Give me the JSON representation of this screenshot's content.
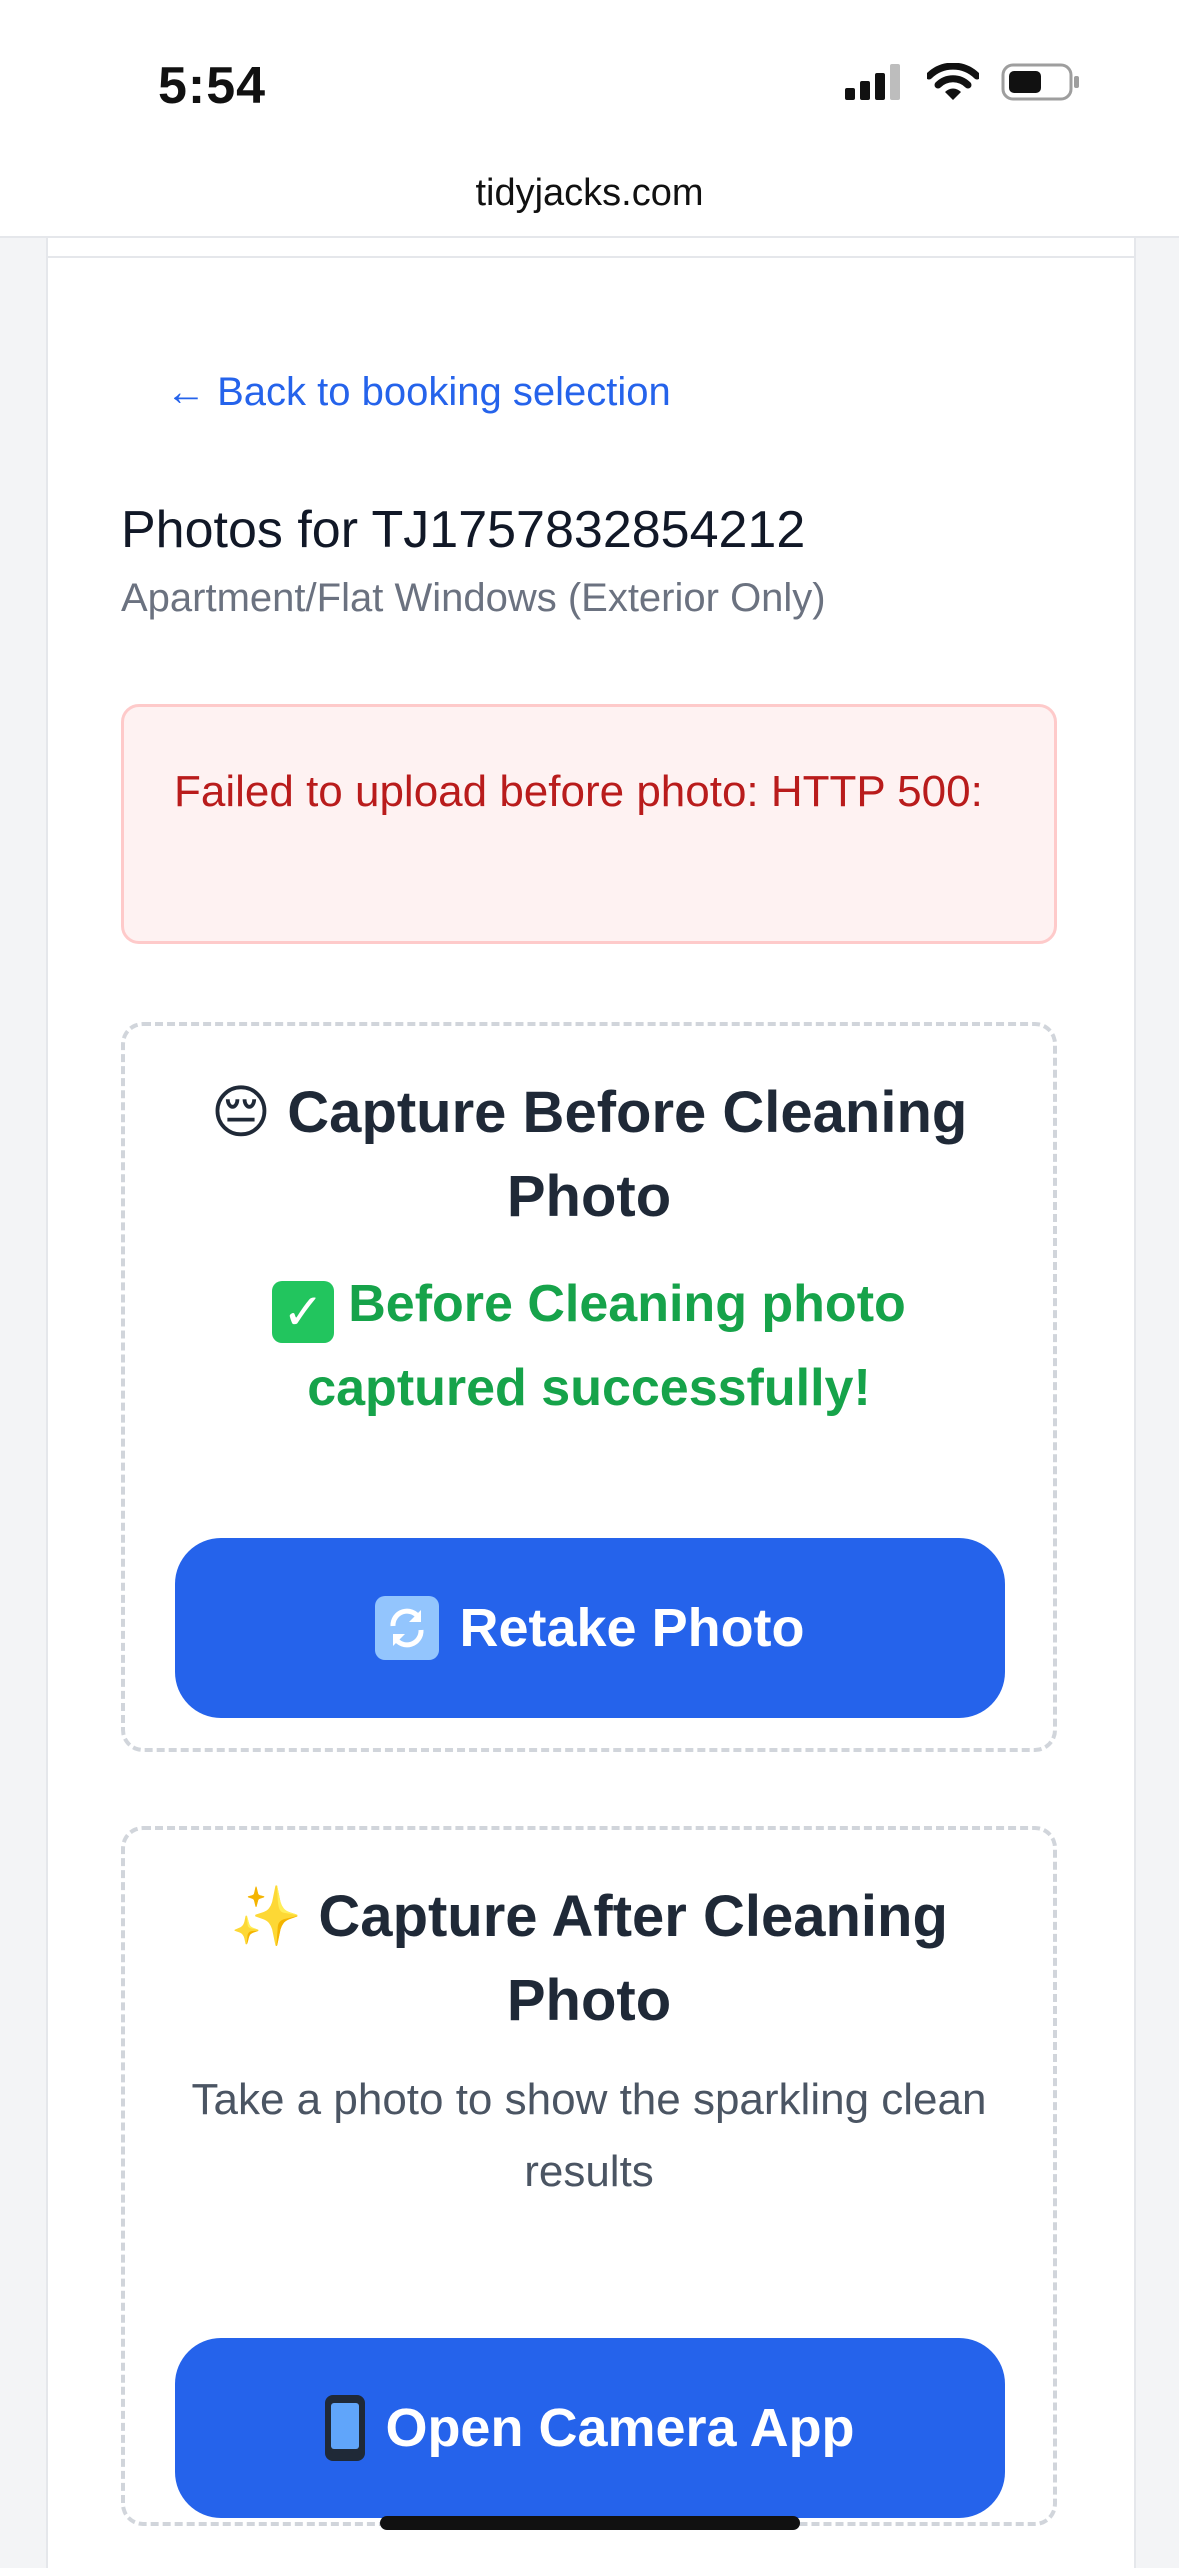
{
  "status_bar": {
    "time": "5:54",
    "icons": [
      "cellular-signal-icon",
      "wifi-icon",
      "battery-icon"
    ]
  },
  "browser": {
    "url": "tidyjacks.com"
  },
  "page": {
    "back_link": "← Back to booking selection",
    "title": "Photos for TJ1757832854212",
    "subtitle": "Apartment/Flat Windows (Exterior Only)",
    "error": "Failed to upload before photo: HTTP 500:"
  },
  "before_section": {
    "title_emoji": "😔",
    "title": "Capture Before Cleaning Photo",
    "success_icon": "check-box-icon",
    "success_message": "Before Cleaning photo captured successfully!",
    "button_icon": "refresh-icon",
    "button_label": "Retake Photo"
  },
  "after_section": {
    "title_emoji": "✨",
    "title": "Capture After Cleaning Photo",
    "description": "Take a photo to show the sparkling clean results",
    "button_icon": "mobile-phone-icon",
    "button_label": "Open Camera App"
  },
  "colors": {
    "primary": "#2563eb",
    "success": "#16a34a",
    "error_text": "#b91c1c",
    "error_bg": "#fef2f2"
  }
}
